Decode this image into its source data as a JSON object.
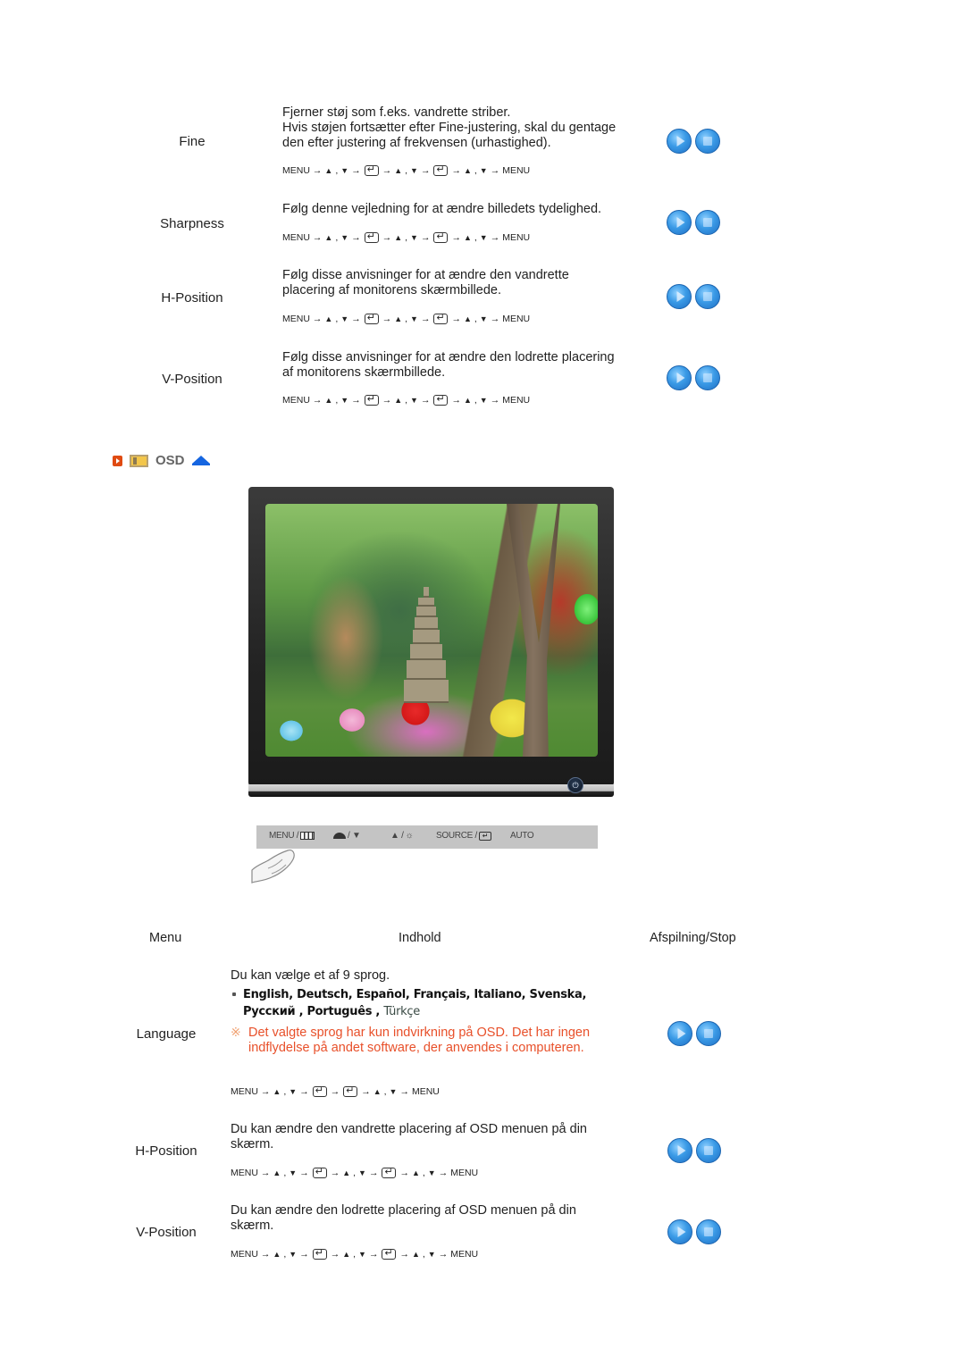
{
  "top_section": {
    "rows": [
      {
        "label": "Fine",
        "description": [
          "Fjerner støj som f.eks. vandrette striber.",
          "Hvis støjen fortsætter efter Fine-justering, skal du gentage",
          "den efter justering af frekvensen (urhastighed)."
        ],
        "sequence": [
          "MENU",
          "→",
          "▲",
          ",",
          "▼",
          "→",
          "[enter]",
          "→",
          "▲",
          ",",
          "▼",
          "→",
          "[enter]",
          "→",
          "▲",
          ",",
          "▼",
          "→",
          "MENU"
        ]
      },
      {
        "label": "Sharpness",
        "description": [
          "Følg denne vejledning for at ændre billedets tydelighed."
        ],
        "sequence": [
          "MENU",
          "→",
          "▲",
          ",",
          "▼",
          "→",
          "[enter]",
          "→",
          "▲",
          ",",
          "▼",
          "→",
          "[enter]",
          "→",
          "▲",
          ",",
          "▼",
          "→",
          "MENU"
        ]
      },
      {
        "label": "H-Position",
        "description": [
          "Følg disse anvisninger for at ændre den vandrette",
          "placering af monitorens skærmbillede."
        ],
        "sequence": [
          "MENU",
          "→",
          "▲",
          ",",
          "▼",
          "→",
          "[enter]",
          "→",
          "▲",
          ",",
          "▼",
          "→",
          "[enter]",
          "→",
          "▲",
          ",",
          "▼",
          "→",
          "MENU"
        ]
      },
      {
        "label": "V-Position",
        "description": [
          "Følg disse anvisninger for at ændre den lodrette placering",
          "af monitorens skærmbillede."
        ],
        "sequence": [
          "MENU",
          "→",
          "▲",
          ",",
          "▼",
          "→",
          "[enter]",
          "→",
          "▲",
          ",",
          "▼",
          "→",
          "[enter]",
          "→",
          "▲",
          ",",
          "▼",
          "→",
          "MENU"
        ]
      }
    ]
  },
  "osd_section": {
    "title": "OSD",
    "icons": [
      "bullet-icon",
      "osd-menu-icon",
      "up-arrow-icon"
    ],
    "control_bar": {
      "menu": "MENU /",
      "down": "/ ▼",
      "up": "▲ /",
      "source": "SOURCE /",
      "auto": "AUTO"
    },
    "columns": {
      "menu": "Menu",
      "content": "Indhold",
      "play_stop": "Afspilning/Stop"
    },
    "rows": [
      {
        "label": "Language",
        "description": [
          "Du kan vælge et af 9 sprog."
        ],
        "languages_line1": "English, Deutsch, Español, Français,  Italiano, Svenska,",
        "languages_line2": "Русский , Português ,",
        "languages_last": "Türkçe",
        "note": [
          "Det valgte sprog har kun indvirkning på OSD. Det har ingen",
          "indflydelse på andet software, der anvendes i computeren."
        ],
        "note_icon": "※",
        "sequence": [
          "MENU",
          "→",
          "▲",
          ",",
          "▼",
          "→",
          "[enter]",
          "→",
          "[enter]",
          "→",
          "▲",
          ",",
          "▼",
          "→",
          "MENU"
        ]
      },
      {
        "label": "H-Position",
        "description": [
          "Du kan ændre den vandrette placering af OSD menuen på din",
          "skærm."
        ],
        "sequence": [
          "MENU",
          "→",
          "▲",
          ",",
          "▼",
          "→",
          "[enter]",
          "→",
          "▲",
          ",",
          "▼",
          "→",
          "[enter]",
          "→",
          "▲",
          ",",
          "▼",
          "→",
          "MENU"
        ]
      },
      {
        "label": "V-Position",
        "description": [
          "Du kan ændre den lodrette placering af OSD menuen på din",
          "skærm."
        ],
        "sequence": [
          "MENU",
          "→",
          "▲",
          ",",
          "▼",
          "→",
          "[enter]",
          "→",
          "▲",
          ",",
          "▼",
          "→",
          "[enter]",
          "→",
          "▲",
          ",",
          "▼",
          "→",
          "MENU"
        ]
      }
    ]
  },
  "buttons": {
    "play": "play-icon",
    "stop": "stop-icon"
  },
  "colors": {
    "note": "#e8502a",
    "accent_blue": "#1565e0",
    "button_blue": "#3a9ae6",
    "bullet_orange": "#e04b12"
  }
}
